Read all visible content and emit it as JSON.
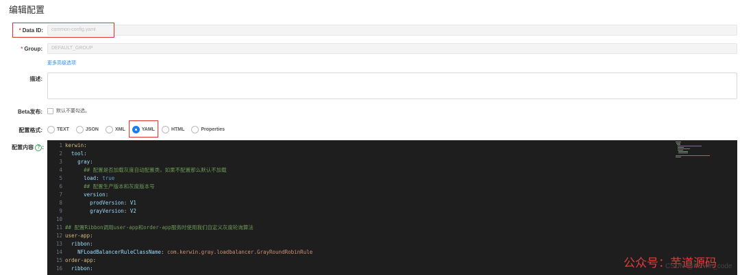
{
  "page_title": "编辑配置",
  "form": {
    "data_id": {
      "label": "Data ID:",
      "value": "common-config.yaml",
      "required": true
    },
    "group": {
      "label": "Group:",
      "value": "DEFAULT_GROUP",
      "required": true
    },
    "more_options_link": "更多高级选项",
    "description": {
      "label": "描述:",
      "value": ""
    },
    "beta": {
      "label": "Beta发布:",
      "checkbox_text": "默认不要勾选。",
      "checked": false
    },
    "format": {
      "label": "配置格式:",
      "options": [
        "TEXT",
        "JSON",
        "XML",
        "YAML",
        "HTML",
        "Properties"
      ],
      "selected": "YAML"
    },
    "content": {
      "label": "配置内容",
      "help_icon": "question-circle-icon"
    }
  },
  "code_lines": [
    {
      "n": "1",
      "ind": "",
      "key": "kerwin",
      "sep": ":",
      "val": "",
      "comment": ""
    },
    {
      "n": "2",
      "ind": "  ",
      "key": "tool",
      "sep": ":",
      "val": "",
      "comment": ""
    },
    {
      "n": "3",
      "ind": "    ",
      "key": "gray",
      "sep": ":",
      "val": "",
      "comment": ""
    },
    {
      "n": "4",
      "ind": "      ",
      "key": "",
      "sep": "",
      "val": "",
      "comment": "## 配置是否加载灰度自动配置类，如果不配置那么默认不加载"
    },
    {
      "n": "5",
      "ind": "      ",
      "key": "load",
      "sep": ": ",
      "val": "true",
      "comment": ""
    },
    {
      "n": "6",
      "ind": "      ",
      "key": "",
      "sep": "",
      "val": "",
      "comment": "## 配置生产版本和灰度版本号"
    },
    {
      "n": "7",
      "ind": "      ",
      "key": "version",
      "sep": ":",
      "val": "",
      "comment": ""
    },
    {
      "n": "8",
      "ind": "        ",
      "key": "prodVersion",
      "sep": ": ",
      "val": "V1",
      "comment": ""
    },
    {
      "n": "9",
      "ind": "        ",
      "key": "grayVersion",
      "sep": ": ",
      "val": "V2",
      "comment": ""
    },
    {
      "n": "10",
      "ind": "",
      "key": "",
      "sep": "",
      "val": "",
      "comment": ""
    },
    {
      "n": "11",
      "ind": "",
      "key": "",
      "sep": "",
      "val": "",
      "comment": "## 配置Ribbon调用user-app和order-app服务时使用我们自定义灰度轮询算法"
    },
    {
      "n": "12",
      "ind": "",
      "key": "user-app",
      "sep": ":",
      "val": "",
      "comment": ""
    },
    {
      "n": "13",
      "ind": "  ",
      "key": "ribbon",
      "sep": ":",
      "val": "",
      "comment": ""
    },
    {
      "n": "14",
      "ind": "    ",
      "key": "NFLoadBalancerRuleClassName",
      "sep": ": ",
      "val": "com.kerwin.gray.loadbalancer.GrayRoundRobinRule",
      "comment": ""
    },
    {
      "n": "15",
      "ind": "",
      "key": "order-app",
      "sep": ":",
      "val": "",
      "comment": ""
    },
    {
      "n": "16",
      "ind": "  ",
      "key": "ribbon",
      "sep": ":",
      "val": "",
      "comment": ""
    }
  ],
  "watermark": "公众号：芋道源码",
  "csdn_credit": "CSDN @kerwin_code",
  "colors": {
    "accent": "#1b7ef0",
    "required": "#e84b40",
    "highlight_box": "#d9352b",
    "editor_bg": "#1e1e1e"
  }
}
